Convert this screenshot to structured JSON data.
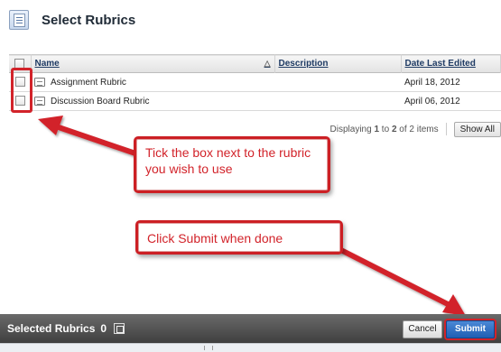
{
  "page": {
    "title": "Select Rubrics"
  },
  "table": {
    "columns": {
      "name": "Name",
      "description": "Description",
      "date": "Date Last Edited"
    },
    "rows": [
      {
        "name": "Assignment Rubric",
        "description": "",
        "date": "April 18, 2012"
      },
      {
        "name": "Discussion Board Rubric",
        "description": "",
        "date": "April 06, 2012"
      }
    ]
  },
  "paging": {
    "prefix": "Displaying ",
    "from": "1",
    "to_word": " to ",
    "to": "2",
    "suffix": " of 2 items",
    "show_all": "Show All"
  },
  "callouts": {
    "tick": "Tick the box next to the rubric you wish to use",
    "submit": "Click Submit when done"
  },
  "footer": {
    "title": "Selected Rubrics",
    "count": "0",
    "cancel": "Cancel",
    "submit": "Submit"
  },
  "colors": {
    "annotation_red": "#d2232a",
    "submit_blue": "#2a6cc0",
    "footer_bg": "#4a4a4a"
  }
}
